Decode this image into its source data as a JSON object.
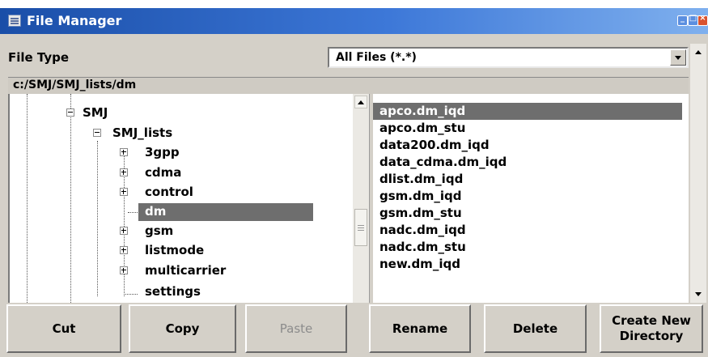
{
  "window": {
    "title": "File Manager"
  },
  "file_type": {
    "label": "File Type",
    "value": "All Files (*.*)"
  },
  "path": "c:/SMJ/SMJ_lists/dm",
  "tree": [
    {
      "label": "SMJ",
      "expander": "minus"
    },
    {
      "label": "SMJ_lists",
      "expander": "minus"
    },
    {
      "label": "3gpp",
      "expander": "plus"
    },
    {
      "label": "cdma",
      "expander": "plus"
    },
    {
      "label": "control",
      "expander": "plus"
    },
    {
      "label": "dm",
      "expander": "none",
      "selected": true
    },
    {
      "label": "gsm",
      "expander": "plus"
    },
    {
      "label": "listmode",
      "expander": "plus"
    },
    {
      "label": "multicarrier",
      "expander": "plus"
    },
    {
      "label": "settings",
      "expander": "none"
    }
  ],
  "files": [
    {
      "name": "apco.dm_iqd",
      "selected": true
    },
    {
      "name": "apco.dm_stu"
    },
    {
      "name": "data200.dm_iqd"
    },
    {
      "name": "data_cdma.dm_iqd"
    },
    {
      "name": "dlist.dm_iqd"
    },
    {
      "name": "gsm.dm_iqd"
    },
    {
      "name": "gsm.dm_stu"
    },
    {
      "name": "nadc.dm_iqd"
    },
    {
      "name": "nadc.dm_stu"
    },
    {
      "name": "new.dm_iqd"
    }
  ],
  "buttons": {
    "cut": "Cut",
    "copy": "Copy",
    "paste": "Paste",
    "rename": "Rename",
    "delete": "Delete",
    "create_dir": "Create New\nDirectory"
  },
  "colors": {
    "title_bar": "#1a4ea8",
    "selection": "#6e6e6e",
    "panel": "#d4d0c8"
  }
}
